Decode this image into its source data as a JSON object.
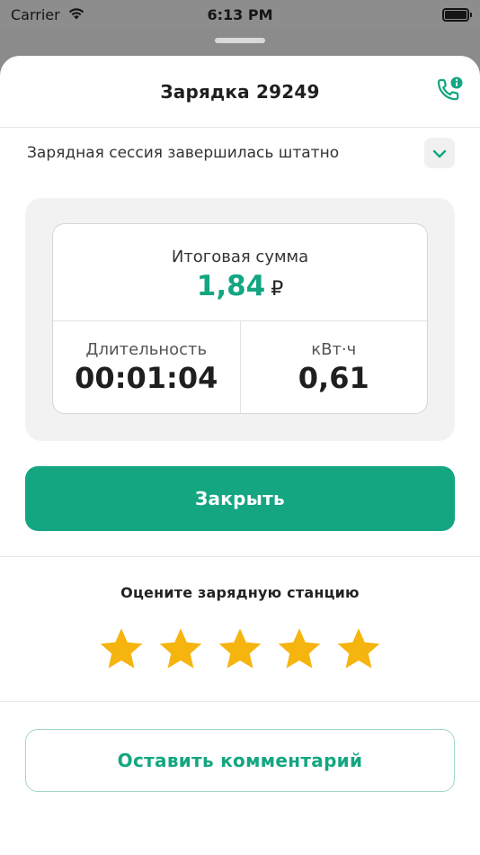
{
  "status_bar": {
    "carrier": "Carrier",
    "time": "6:13 PM"
  },
  "header": {
    "title": "Зарядка 29249",
    "support_icon": "phone-info-icon"
  },
  "session": {
    "status_text": "Зарядная сессия завершилась штатно"
  },
  "summary": {
    "total_label": "Итоговая сумма",
    "total_value": "1,84",
    "currency": "₽",
    "duration_label": "Длительность",
    "duration_value": "00:01:04",
    "energy_label": "кВт·ч",
    "energy_value": "0,61"
  },
  "actions": {
    "close_label": "Закрыть",
    "comment_label": "Оставить комментарий"
  },
  "rating": {
    "title": "Оцените зарядную станцию",
    "max_stars": 5,
    "filled_stars": 5
  },
  "colors": {
    "accent": "#13a681",
    "star": "#f6b40f"
  }
}
